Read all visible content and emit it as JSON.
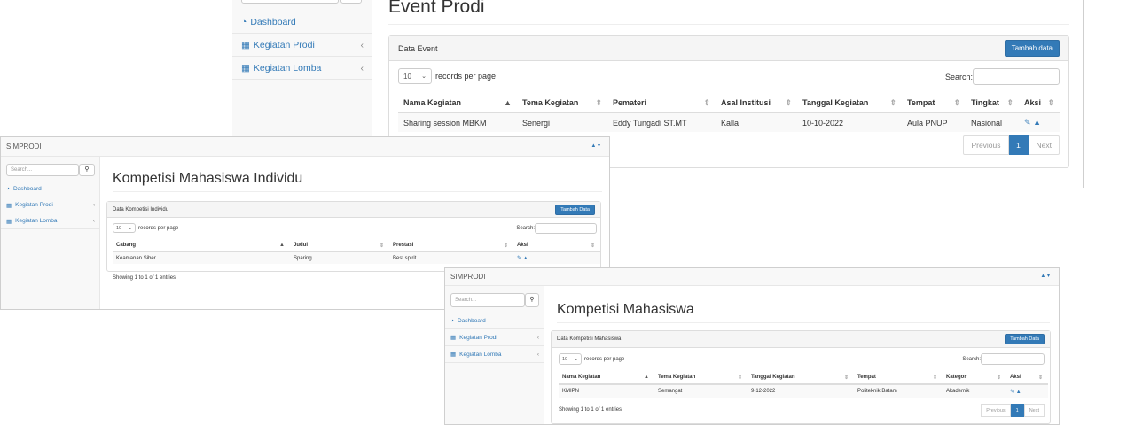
{
  "screen1": {
    "sidebar": {
      "items": [
        {
          "icon": "dashboard-icon",
          "label": "Dashboard",
          "chevron": ""
        },
        {
          "icon": "chart-icon",
          "label": "Kegiatan Prodi",
          "chevron": "‹"
        },
        {
          "icon": "chart-icon",
          "label": "Kegiatan Lomba",
          "chevron": "‹"
        }
      ]
    },
    "page_title": "Event Prodi",
    "panel": {
      "heading": "Data Event",
      "add_button": "Tambah data"
    },
    "length": {
      "value": "10",
      "suffix": "records per page"
    },
    "search": {
      "label": "Search:",
      "value": ""
    },
    "table": {
      "headers": [
        "Nama Kegiatan",
        "Tema Kegiatan",
        "Pemateri",
        "Asal Institusi",
        "Tanggal Kegiatan",
        "Tempat",
        "Tingkat",
        "Aksi"
      ],
      "rows": [
        [
          "Sharing session MBKM",
          "Senergi",
          "Eddy Tungadi ST.MT",
          "Kalla",
          "10-10-2022",
          "Aula PNUP",
          "Nasional"
        ]
      ]
    },
    "pagination": {
      "previous": "Previous",
      "current": "1",
      "next": "Next"
    }
  },
  "screen2": {
    "brand": "SIMPRODI",
    "user_menu": "▲ ▾",
    "search": {
      "placeholder": "Search..."
    },
    "sidebar": {
      "items": [
        {
          "icon": "dashboard-icon",
          "label": "Dashboard",
          "chevron": ""
        },
        {
          "icon": "chart-icon",
          "label": "Kegiatan Prodi",
          "chevron": "‹"
        },
        {
          "icon": "chart-icon",
          "label": "Kegiatan Lomba",
          "chevron": "‹"
        }
      ]
    },
    "page_title": "Kompetisi Mahasiswa Individu",
    "panel": {
      "heading": "Data Kompetisi Individu",
      "add_button": "Tambah Data"
    },
    "length": {
      "value": "10",
      "suffix": "records per page"
    },
    "table_search": {
      "label": "Search:",
      "value": ""
    },
    "table": {
      "headers": [
        "Cabang",
        "Judul",
        "Prestasi",
        "Aksi"
      ],
      "rows": [
        [
          "Keamanan Siber",
          "Sparing",
          "Best spirit"
        ]
      ]
    },
    "info": "Showing 1 to 1 of 1 entries"
  },
  "screen3": {
    "brand": "SIMPRODI",
    "user_menu": "▲ ▾",
    "search": {
      "placeholder": "Search..."
    },
    "sidebar": {
      "items": [
        {
          "icon": "dashboard-icon",
          "label": "Dashboard",
          "chevron": ""
        },
        {
          "icon": "chart-icon",
          "label": "Kegiatan Prodi",
          "chevron": "‹"
        },
        {
          "icon": "chart-icon",
          "label": "Kegiatan Lomba",
          "chevron": "‹"
        }
      ]
    },
    "page_title": "Kompetisi Mahasiswa",
    "panel": {
      "heading": "Data Kompetisi Mahasiswa",
      "add_button": "Tambah Data"
    },
    "length": {
      "value": "10",
      "suffix": "records per page"
    },
    "table_search": {
      "label": "Search:",
      "value": ""
    },
    "table": {
      "headers": [
        "Nama Kegiatan",
        "Tema Kegiatan",
        "Tanggal Kegiatan",
        "Tempat",
        "Kategori",
        "Aksi"
      ],
      "rows": [
        [
          "KMIPN",
          "Semangat",
          "9-12-2022",
          "Politeknik Batam",
          "Akademik"
        ]
      ]
    },
    "info": "Showing 1 to 1 of 1 entries",
    "pagination": {
      "previous": "Previous",
      "current": "1",
      "next": "Next"
    }
  },
  "colors": {
    "primary": "#337ab7",
    "sidebar_bg": "#f8f8f8",
    "border": "#dddddd"
  }
}
